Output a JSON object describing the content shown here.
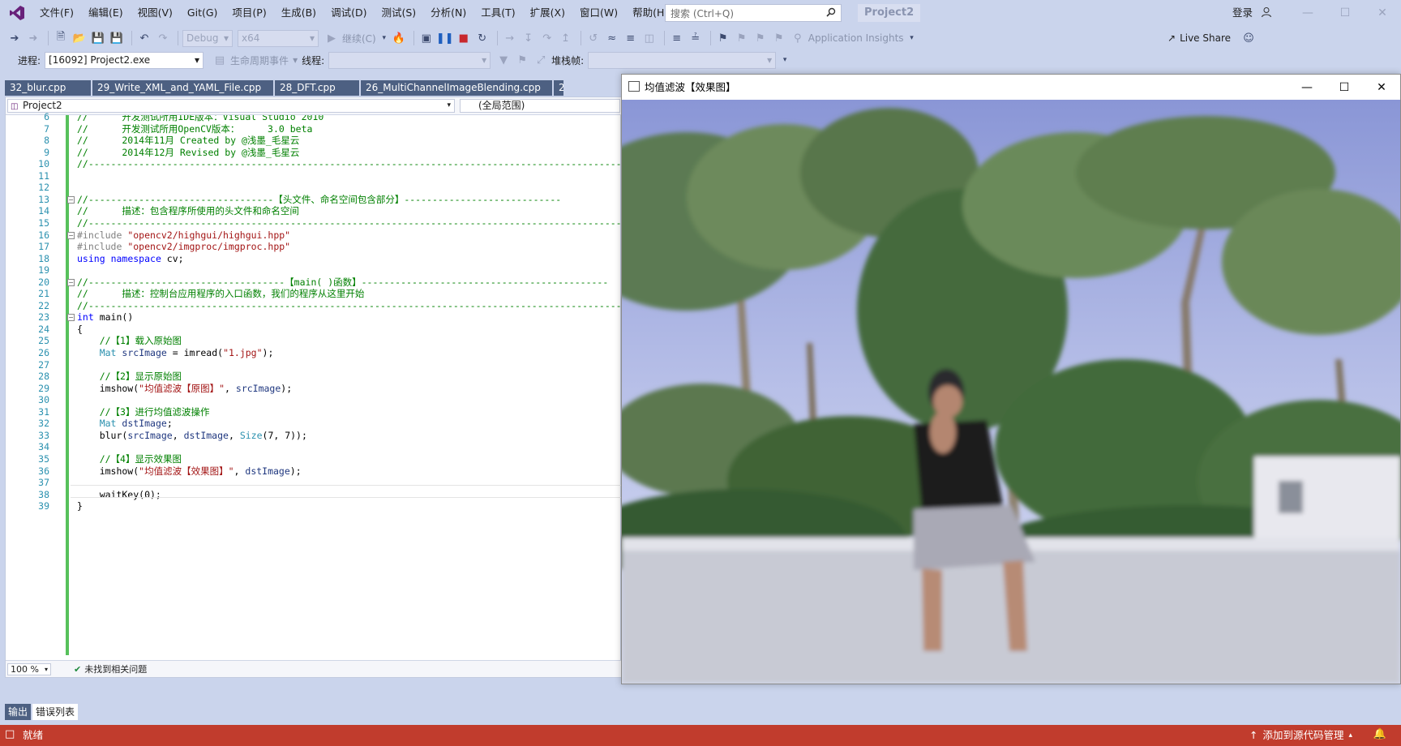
{
  "titlebar": {
    "menus": [
      "文件(F)",
      "编辑(E)",
      "视图(V)",
      "Git(G)",
      "项目(P)",
      "生成(B)",
      "调试(D)",
      "测试(S)",
      "分析(N)",
      "工具(T)",
      "扩展(X)",
      "窗口(W)",
      "帮助(H)"
    ],
    "search_placeholder": "搜索 (Ctrl+Q)",
    "project_name": "Project2",
    "login": "登录",
    "live_share": "Live Share"
  },
  "toolbar1": {
    "config": "Debug",
    "platform": "x64",
    "continue_label": "继续(C)",
    "app_insights": "Application Insights"
  },
  "toolbar2": {
    "process_label": "进程:",
    "process_value": "[16092] Project2.exe",
    "lifecycle_label": "生命周期事件",
    "thread_label": "线程:",
    "stackframe_label": "堆栈帧:"
  },
  "tabs": [
    "32_blur.cpp",
    "29_Write_XML_and_YAML_File.cpp",
    "28_DFT.cpp",
    "26_MultiChannelImageBlending.cpp",
    "2"
  ],
  "editor": {
    "project_dropdown": "Project2",
    "scope_dropdown": "(全局范围)",
    "zoom": "100 %",
    "issues": "未找到相关问题",
    "lines": [
      {
        "n": "6",
        "t": "//      开发测试所用IDE版本：Visual Studio 2010"
      },
      {
        "n": "7",
        "t": "//      开发测试所用OpenCV版本：     3.0 beta"
      },
      {
        "n": "8",
        "t": "//      2014年11月 Created by @浅墨_毛星云"
      },
      {
        "n": "9",
        "t": "//      2014年12月 Revised by @浅墨_毛星云"
      },
      {
        "n": "10",
        "t": "//------------------------------------------------------------------------------------------------"
      },
      {
        "n": "11",
        "t": ""
      },
      {
        "n": "12",
        "t": ""
      },
      {
        "n": "13",
        "t": "//---------------------------------【头文件、命名空间包含部分】----------------------------"
      },
      {
        "n": "14",
        "t": "//      描述：包含程序所使用的头文件和命名空间"
      },
      {
        "n": "15",
        "t": "//------------------------------------------------------------------------------------------------"
      },
      {
        "n": "16",
        "t": "#include \"opencv2/highgui/highgui.hpp\""
      },
      {
        "n": "17",
        "t": "#include \"opencv2/imgproc/imgproc.hpp\""
      },
      {
        "n": "18",
        "t": "using namespace cv;"
      },
      {
        "n": "19",
        "t": ""
      },
      {
        "n": "20",
        "t": "//-----------------------------------【main( )函数】--------------------------------------------"
      },
      {
        "n": "21",
        "t": "//      描述：控制台应用程序的入口函数，我们的程序从这里开始"
      },
      {
        "n": "22",
        "t": "//------------------------------------------------------------------------------------------------"
      },
      {
        "n": "23",
        "t": "int main()"
      },
      {
        "n": "24",
        "t": "{"
      },
      {
        "n": "25",
        "t": "    //【1】载入原始图"
      },
      {
        "n": "26",
        "t": "    Mat srcImage = imread(\"1.jpg\");"
      },
      {
        "n": "27",
        "t": ""
      },
      {
        "n": "28",
        "t": "    //【2】显示原始图"
      },
      {
        "n": "29",
        "t": "    imshow(\"均值滤波【原图】\", srcImage);"
      },
      {
        "n": "30",
        "t": ""
      },
      {
        "n": "31",
        "t": "    //【3】进行均值滤波操作"
      },
      {
        "n": "32",
        "t": "    Mat dstImage;"
      },
      {
        "n": "33",
        "t": "    blur(srcImage, dstImage, Size(7, 7));"
      },
      {
        "n": "34",
        "t": ""
      },
      {
        "n": "35",
        "t": "    //【4】显示效果图"
      },
      {
        "n": "36",
        "t": "    imshow(\"均值滤波【效果图】\", dstImage);"
      },
      {
        "n": "37",
        "t": ""
      },
      {
        "n": "38",
        "t": "    waitKey(0);"
      },
      {
        "n": "39",
        "t": "}"
      }
    ]
  },
  "bottom_tabs": [
    "输出",
    "错误列表"
  ],
  "statusbar": {
    "ready": "就绪",
    "source_control": "添加到源代码管理"
  },
  "image_window": {
    "title": "均值滤波【效果图】"
  },
  "colors": {
    "chrome": "#cad4ec",
    "status": "#c13c2d",
    "tab": "#4d6082",
    "change_bar": "#57c15b"
  }
}
